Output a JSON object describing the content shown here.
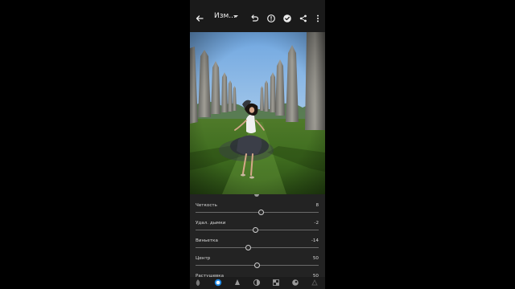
{
  "header": {
    "title": "Изм...",
    "icons": [
      "back-arrow-icon",
      "dropdown-caret-icon",
      "undo-icon",
      "info-icon",
      "checkmark-icon",
      "share-icon",
      "more-vert-icon"
    ]
  },
  "sliders": [
    {
      "label": "Четкость",
      "value": "8"
    },
    {
      "label": "Удал. дымки",
      "value": "-2"
    },
    {
      "label": "Виньетка",
      "value": "-14"
    },
    {
      "label": "Центр",
      "value": "50"
    },
    {
      "label": "Растушевка",
      "value": "50"
    }
  ],
  "slider_levels": [
    0.58,
    0.49,
    0.43,
    0.5,
    0.5
  ],
  "toolbar": {
    "icons": [
      "presets-icon",
      "light-icon",
      "color-icon",
      "effects-icon",
      "detail-icon",
      "optics-icon",
      "geometry-icon"
    ],
    "active": "light-icon"
  },
  "colors": {
    "background": "#000000",
    "panel": "#232323",
    "accent": "#1e88e5"
  }
}
